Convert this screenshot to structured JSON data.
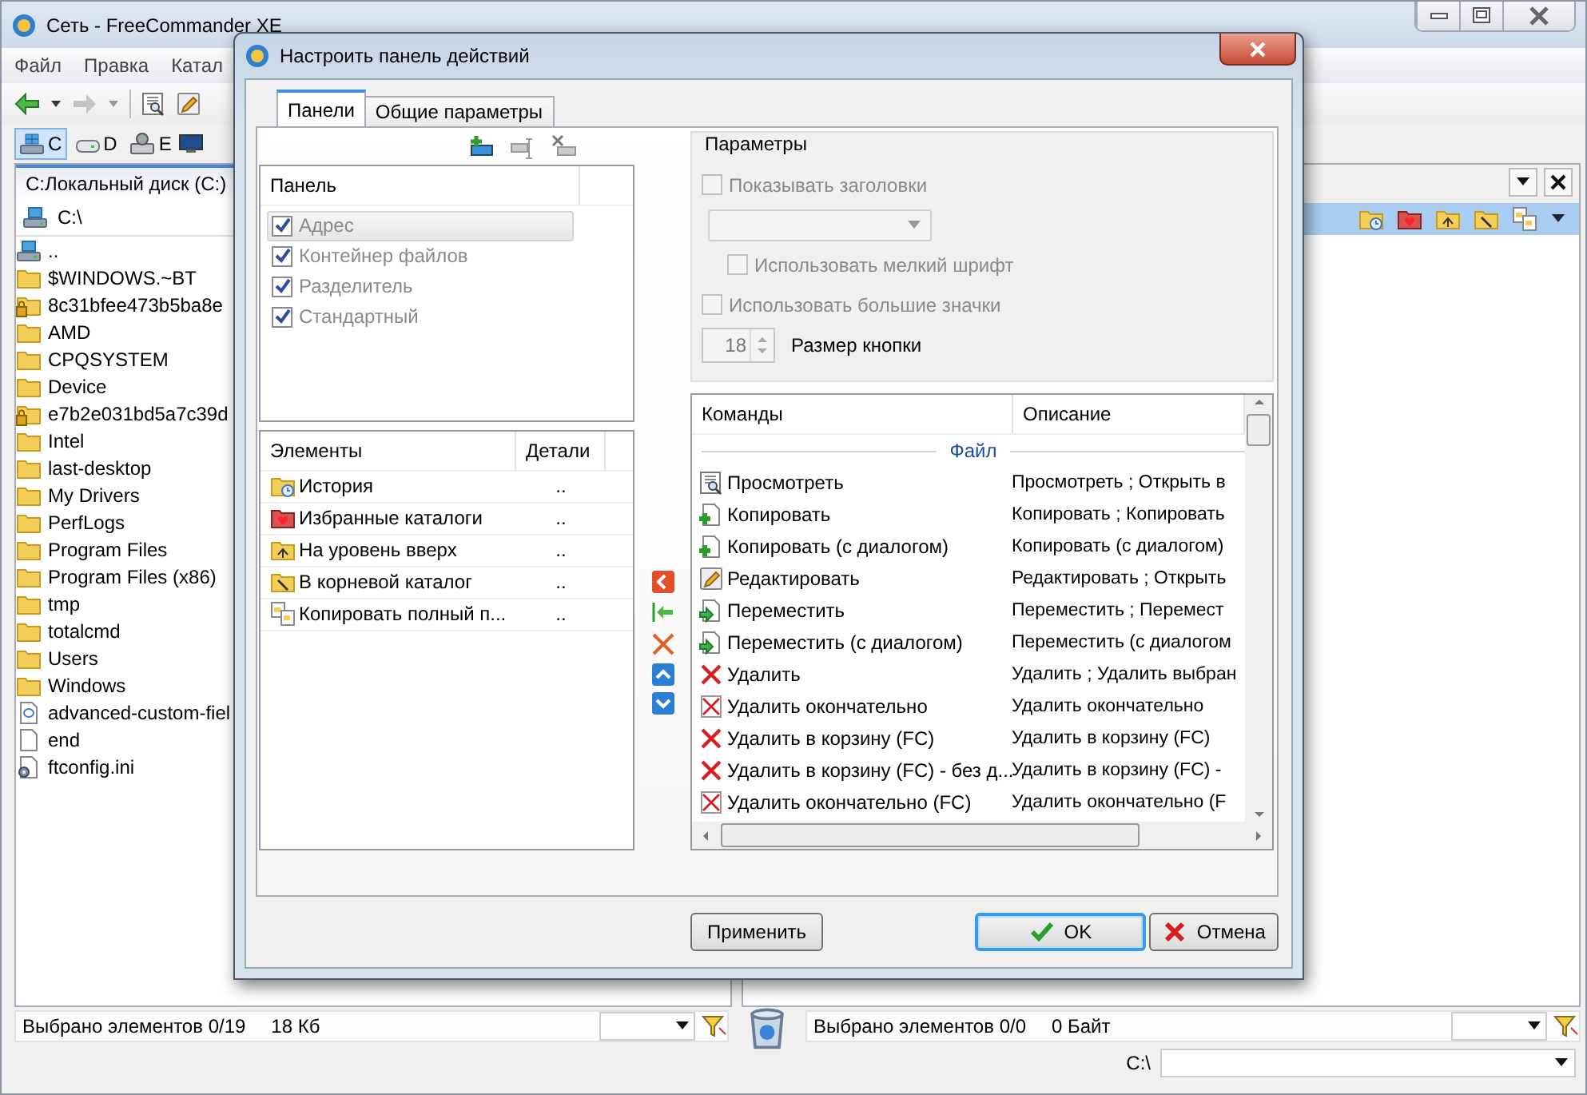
{
  "window": {
    "title": "Сеть - FreeCommander XE"
  },
  "menu": [
    {
      "label": "Файл"
    },
    {
      "label": "Правка"
    },
    {
      "label": "Катал"
    }
  ],
  "drives": [
    {
      "label": "C",
      "kind": "system",
      "selected": true
    },
    {
      "label": "D",
      "kind": "disk",
      "selected": false
    },
    {
      "label": "E",
      "kind": "network",
      "selected": false
    }
  ],
  "left_panel": {
    "tab": "C:Локальный диск (C:)",
    "path": "C:\\",
    "files": [
      {
        "name": "..",
        "kind": "up"
      },
      {
        "name": "$WINDOWS.~BT",
        "kind": "folder"
      },
      {
        "name": "8c31bfee473b5ba8e",
        "kind": "locked"
      },
      {
        "name": "AMD",
        "kind": "folder"
      },
      {
        "name": "CPQSYSTEM",
        "kind": "folder"
      },
      {
        "name": "Device",
        "kind": "folder"
      },
      {
        "name": "e7b2e031bd5a7c39d",
        "kind": "locked"
      },
      {
        "name": "Intel",
        "kind": "folder"
      },
      {
        "name": "last-desktop",
        "kind": "folder"
      },
      {
        "name": "My Drivers",
        "kind": "folder"
      },
      {
        "name": "PerfLogs",
        "kind": "folder"
      },
      {
        "name": "Program Files",
        "kind": "folder"
      },
      {
        "name": "Program Files (x86)",
        "kind": "folder"
      },
      {
        "name": "tmp",
        "kind": "folder"
      },
      {
        "name": "totalcmd",
        "kind": "folder"
      },
      {
        "name": "Users",
        "kind": "folder"
      },
      {
        "name": "Windows",
        "kind": "folder"
      },
      {
        "name": "advanced-custom-fiel",
        "kind": "web"
      },
      {
        "name": "end",
        "kind": "file"
      },
      {
        "name": "ftconfig.ini",
        "kind": "config"
      }
    ],
    "status_count": "Выбрано элементов 0/19",
    "status_size": "18 Кб"
  },
  "right_panel": {
    "status_count": "Выбрано элементов 0/0",
    "status_size": "0 Байт"
  },
  "path_bar": {
    "label": "C:\\"
  },
  "dialog": {
    "title": "Настроить панель действий",
    "tabs": [
      {
        "label": "Панели",
        "selected": true
      },
      {
        "label": "Общие параметры",
        "selected": false
      }
    ],
    "panels": {
      "column": "Панель",
      "items": [
        {
          "label": "Адрес",
          "checked": true,
          "selected": true
        },
        {
          "label": "Контейнер файлов",
          "checked": true,
          "selected": false
        },
        {
          "label": "Разделитель",
          "checked": true,
          "selected": false
        },
        {
          "label": "Стандартный",
          "checked": true,
          "selected": false
        }
      ]
    },
    "elements": {
      "columns": [
        "Элементы",
        "Детали"
      ],
      "rows": [
        {
          "kind": "history",
          "label": "История",
          "details": ".."
        },
        {
          "kind": "favorites",
          "label": "Избранные каталоги",
          "details": ".."
        },
        {
          "kind": "up",
          "label": "На уровень вверх",
          "details": ".."
        },
        {
          "kind": "root",
          "label": "В корневой каталог",
          "details": ".."
        },
        {
          "kind": "copypath",
          "label": "Копировать полный п...",
          "details": ".."
        }
      ]
    },
    "parameters": {
      "title": "Параметры",
      "options": [
        {
          "kind": "checkbox",
          "label": "Показывать заголовки",
          "checked": false,
          "disabled": true,
          "children": [
            {
              "kind": "dropdown",
              "disabled": true
            },
            {
              "kind": "checkbox",
              "label": "Использовать мелкий шрифт",
              "checked": false,
              "disabled": true
            }
          ]
        },
        {
          "kind": "checkbox",
          "label": "Использовать большие значки",
          "checked": false,
          "disabled": true
        },
        {
          "kind": "spinner",
          "value": "18",
          "label": "Размер кнопки",
          "disabled": true
        }
      ]
    },
    "commands": {
      "columns": [
        "Команды",
        "Описание"
      ],
      "groups": [
        {
          "label": "Файл",
          "rows": [
            {
              "kind": "view",
              "command": "Просмотреть",
              "description": "Просмотреть ; Открыть в"
            },
            {
              "kind": "copy",
              "command": "Копировать",
              "description": "Копировать ; Копировать"
            },
            {
              "kind": "copy",
              "command": "Копировать (с диалогом)",
              "description": "Копировать (с диалогом)"
            },
            {
              "kind": "edit",
              "command": "Редактировать",
              "description": "Редактировать ; Открыть"
            },
            {
              "kind": "move",
              "command": "Переместить",
              "description": "Переместить ; Перемест"
            },
            {
              "kind": "move",
              "command": "Переместить (с диалогом)",
              "description": "Переместить (с диалогом"
            },
            {
              "kind": "delete",
              "command": "Удалить",
              "description": "Удалить ; Удалить выбран"
            },
            {
              "kind": "wipe",
              "command": "Удалить окончательно",
              "description": "Удалить окончательно"
            },
            {
              "kind": "delete",
              "command": "Удалить в корзину (FC)",
              "description": "Удалить в корзину (FC)"
            },
            {
              "kind": "delete",
              "command": "Удалить в корзину (FC) - без д...",
              "description": "Удалить в корзину (FC) -"
            },
            {
              "kind": "wipe",
              "command": "Удалить окончательно (FC)",
              "description": "Удалить окончательно (F"
            }
          ]
        }
      ]
    },
    "buttons": [
      {
        "kind": "apply",
        "label": "Применить",
        "default": false
      },
      {
        "kind": "ok",
        "label": "OK",
        "default": true
      },
      {
        "kind": "cancel",
        "label": "Отмена",
        "default": false
      }
    ]
  }
}
